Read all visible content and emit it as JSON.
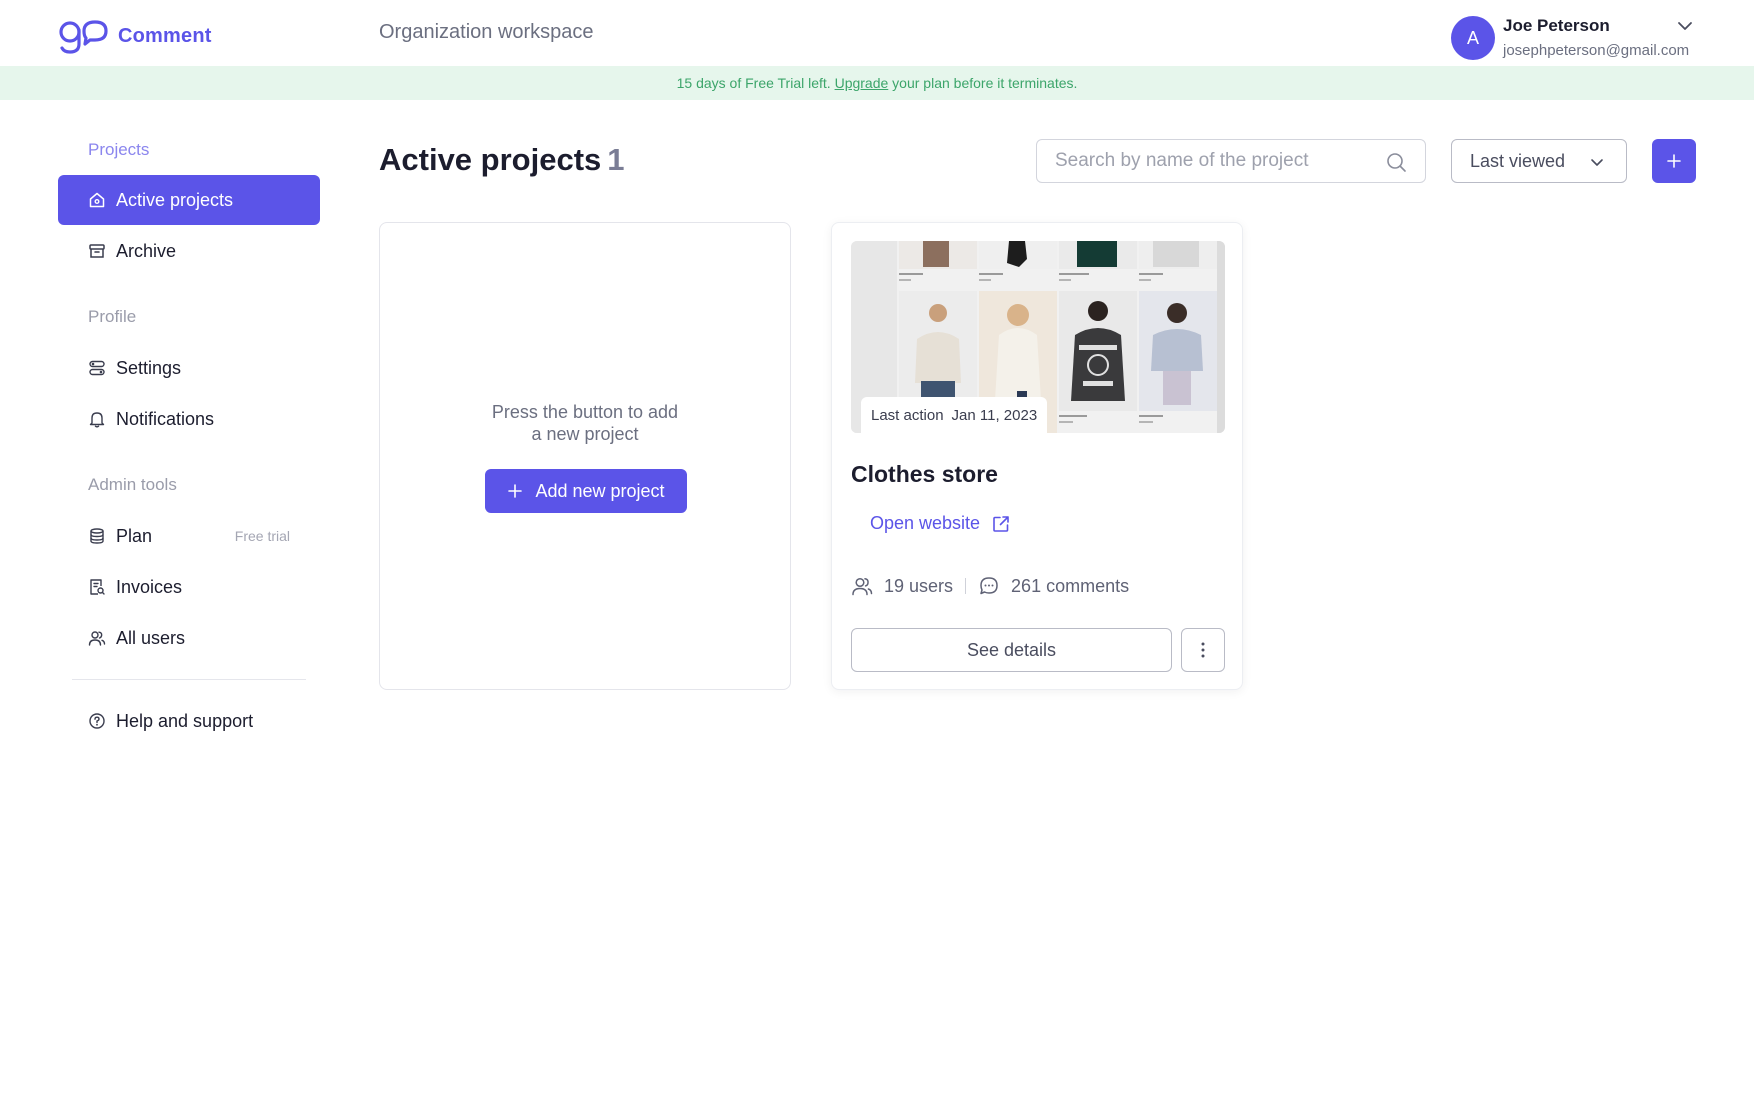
{
  "app": {
    "logo_text": "Comment",
    "workspace_label": "Organization workspace",
    "brand_color": "#5b54e8"
  },
  "user": {
    "avatar_initial": "A",
    "name": "Joe Peterson",
    "email": "josephpeterson@gmail.com"
  },
  "trial_banner": {
    "prefix": "15 days of Free Trial left.",
    "link": "Upgrade",
    "suffix": "your plan before it terminates."
  },
  "sidebar": {
    "projects_heading": "Projects",
    "active_projects": "Active projects",
    "archive": "Archive",
    "profile_heading": "Profile",
    "settings": "Settings",
    "notifications": "Notifications",
    "admin_heading": "Admin tools",
    "plan": "Plan",
    "plan_badge": "Free trial",
    "invoices": "Invoices",
    "all_users": "All users",
    "help": "Help and support"
  },
  "main": {
    "title": "Active projects",
    "count": "1",
    "search_placeholder": "Search by name of the project",
    "sort_value": "Last viewed"
  },
  "empty_card": {
    "line1": "Press the button to add",
    "line2": "a new project",
    "button": "Add new project"
  },
  "project": {
    "last_action_label": "Last action",
    "last_action_date": "Jan 11, 2023",
    "title": "Clothes store",
    "open_website": "Open website",
    "users": "19 users",
    "comments": "261 comments",
    "details_button": "See details"
  }
}
